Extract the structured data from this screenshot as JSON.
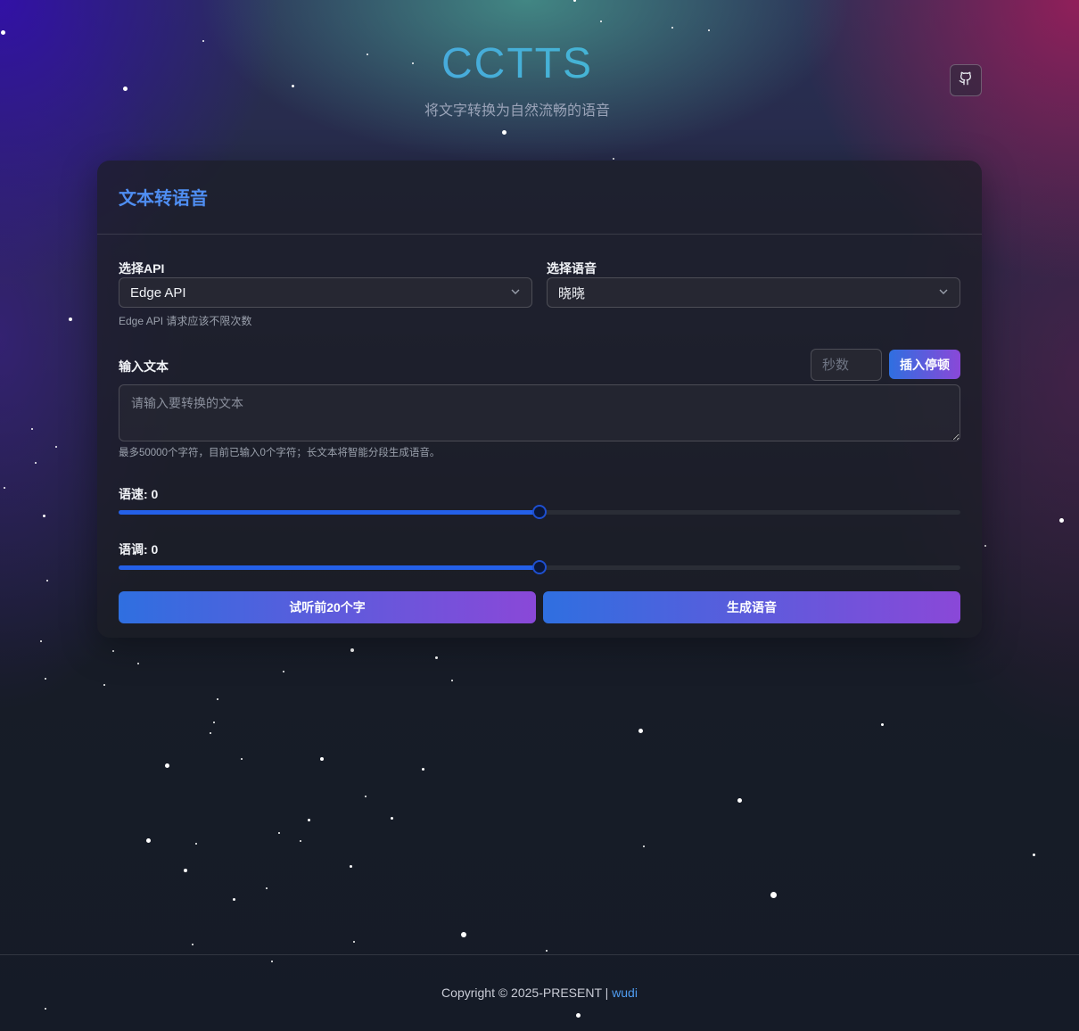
{
  "header": {
    "title": "CCTTS",
    "subtitle": "将文字转换为自然流畅的语音",
    "github_icon": "github-icon"
  },
  "card": {
    "title": "文本转语音",
    "api": {
      "label": "选择API",
      "value": "Edge API",
      "hint": "Edge API 请求应该不限次数"
    },
    "voice": {
      "label": "选择语音",
      "value": "晓晓"
    },
    "text": {
      "label": "输入文本",
      "seconds_placeholder": "秒数",
      "insert_pause_label": "插入停顿",
      "placeholder": "请输入要转换的文本",
      "value": "",
      "hint": "最多50000个字符，目前已输入0个字符；长文本将智能分段生成语音。"
    },
    "rate": {
      "label": "语速: 0",
      "fraction": 0.5
    },
    "pitch": {
      "label": "语调: 0",
      "fraction": 0.5
    },
    "preview_label": "试听前20个字",
    "generate_label": "生成语音"
  },
  "footer": {
    "copyright": "Copyright © 2025-PRESENT |",
    "author": "wudi"
  },
  "colors": {
    "accent": "#4f8ef2",
    "button_gradient_start": "#2f6fe0",
    "button_gradient_end": "#8a48d8",
    "slider_fill": "#2460e8",
    "link": "#4f9cf0"
  }
}
